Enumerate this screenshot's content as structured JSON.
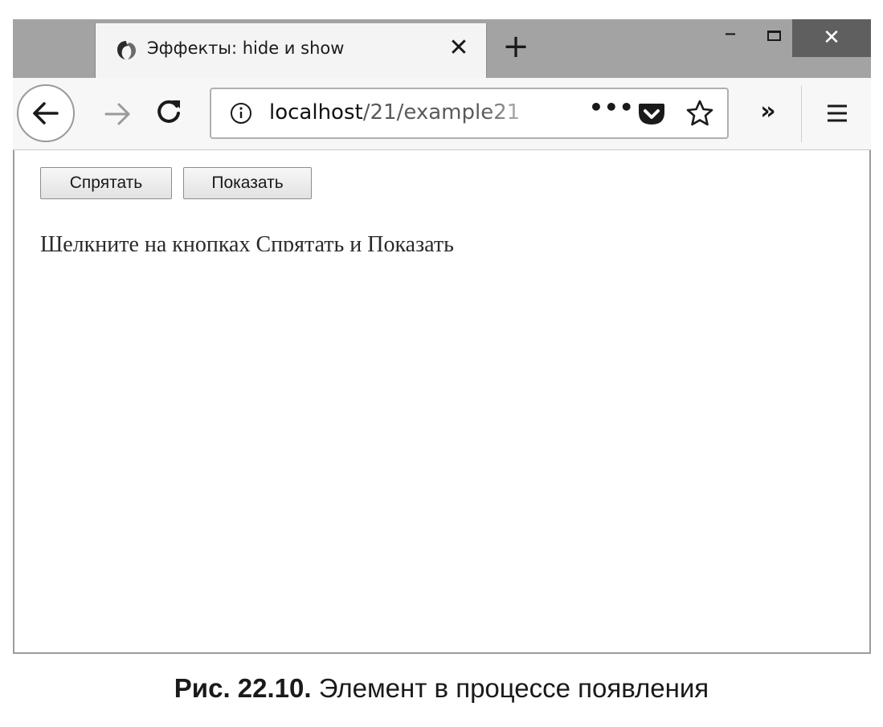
{
  "browser": {
    "tab": {
      "title": "Эффекты: hide и show",
      "close_glyph": "✕",
      "favicon_icon": "firefox-dev-icon"
    },
    "new_tab_glyph": "+",
    "window_controls": {
      "minimize_glyph": "–",
      "close_glyph": "✕"
    },
    "navigation": {
      "back_icon": "back-arrow-icon",
      "forward_icon": "forward-arrow-icon",
      "reload_icon": "reload-icon"
    },
    "address_bar": {
      "host": "localhost",
      "path": "/21/example21",
      "more_glyph": "•••",
      "info_icon": "info-icon",
      "pocket_icon": "pocket-icon",
      "bookmark_icon": "star-icon"
    },
    "overflow_glyph": "»",
    "menu_icon": "hamburger-menu-icon"
  },
  "page": {
    "buttons": {
      "hide_label": "Спрятать",
      "show_label": "Показать"
    },
    "text": "Щелкните на кнопках Спрятать и Показать"
  },
  "caption": {
    "figure_number": "Рис. 22.10.",
    "text": "Элемент в процессе появления"
  },
  "colors": {
    "titlebar": "#a3a3a3",
    "close_button": "#5f5f5f",
    "toolbar": "#f7f7f7",
    "content": "#ffffff"
  }
}
